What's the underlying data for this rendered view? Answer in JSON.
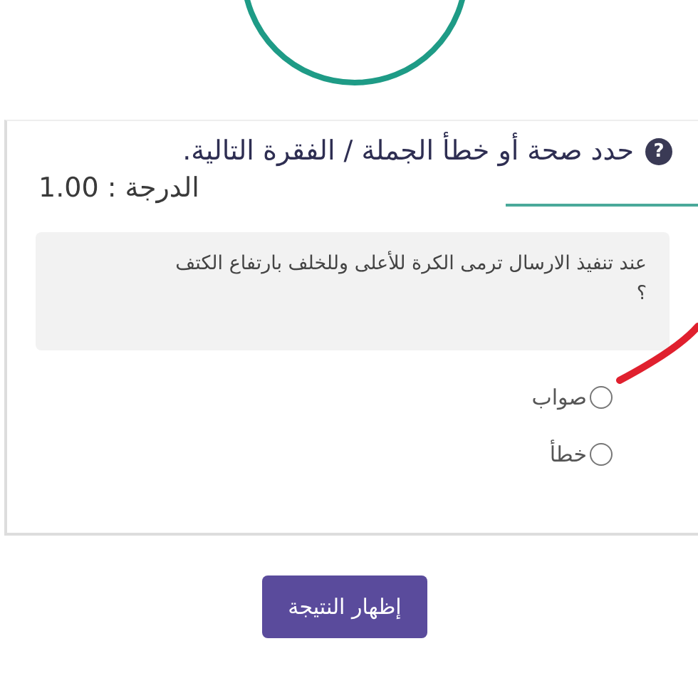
{
  "question": {
    "title": "حدد صحة أو خطأ الجملة / الفقرة التالية.",
    "help_icon": "?",
    "grade": "الدرجة : 1.00",
    "text": "عند تنفيذ الارسال ترمى الكرة للأعلى وللخلف بارتفاع الكتف ؟",
    "options": [
      {
        "label": "صواب",
        "selected": false
      },
      {
        "label": "خطأ",
        "selected": false
      }
    ]
  },
  "button": "إظهار النتيجة"
}
